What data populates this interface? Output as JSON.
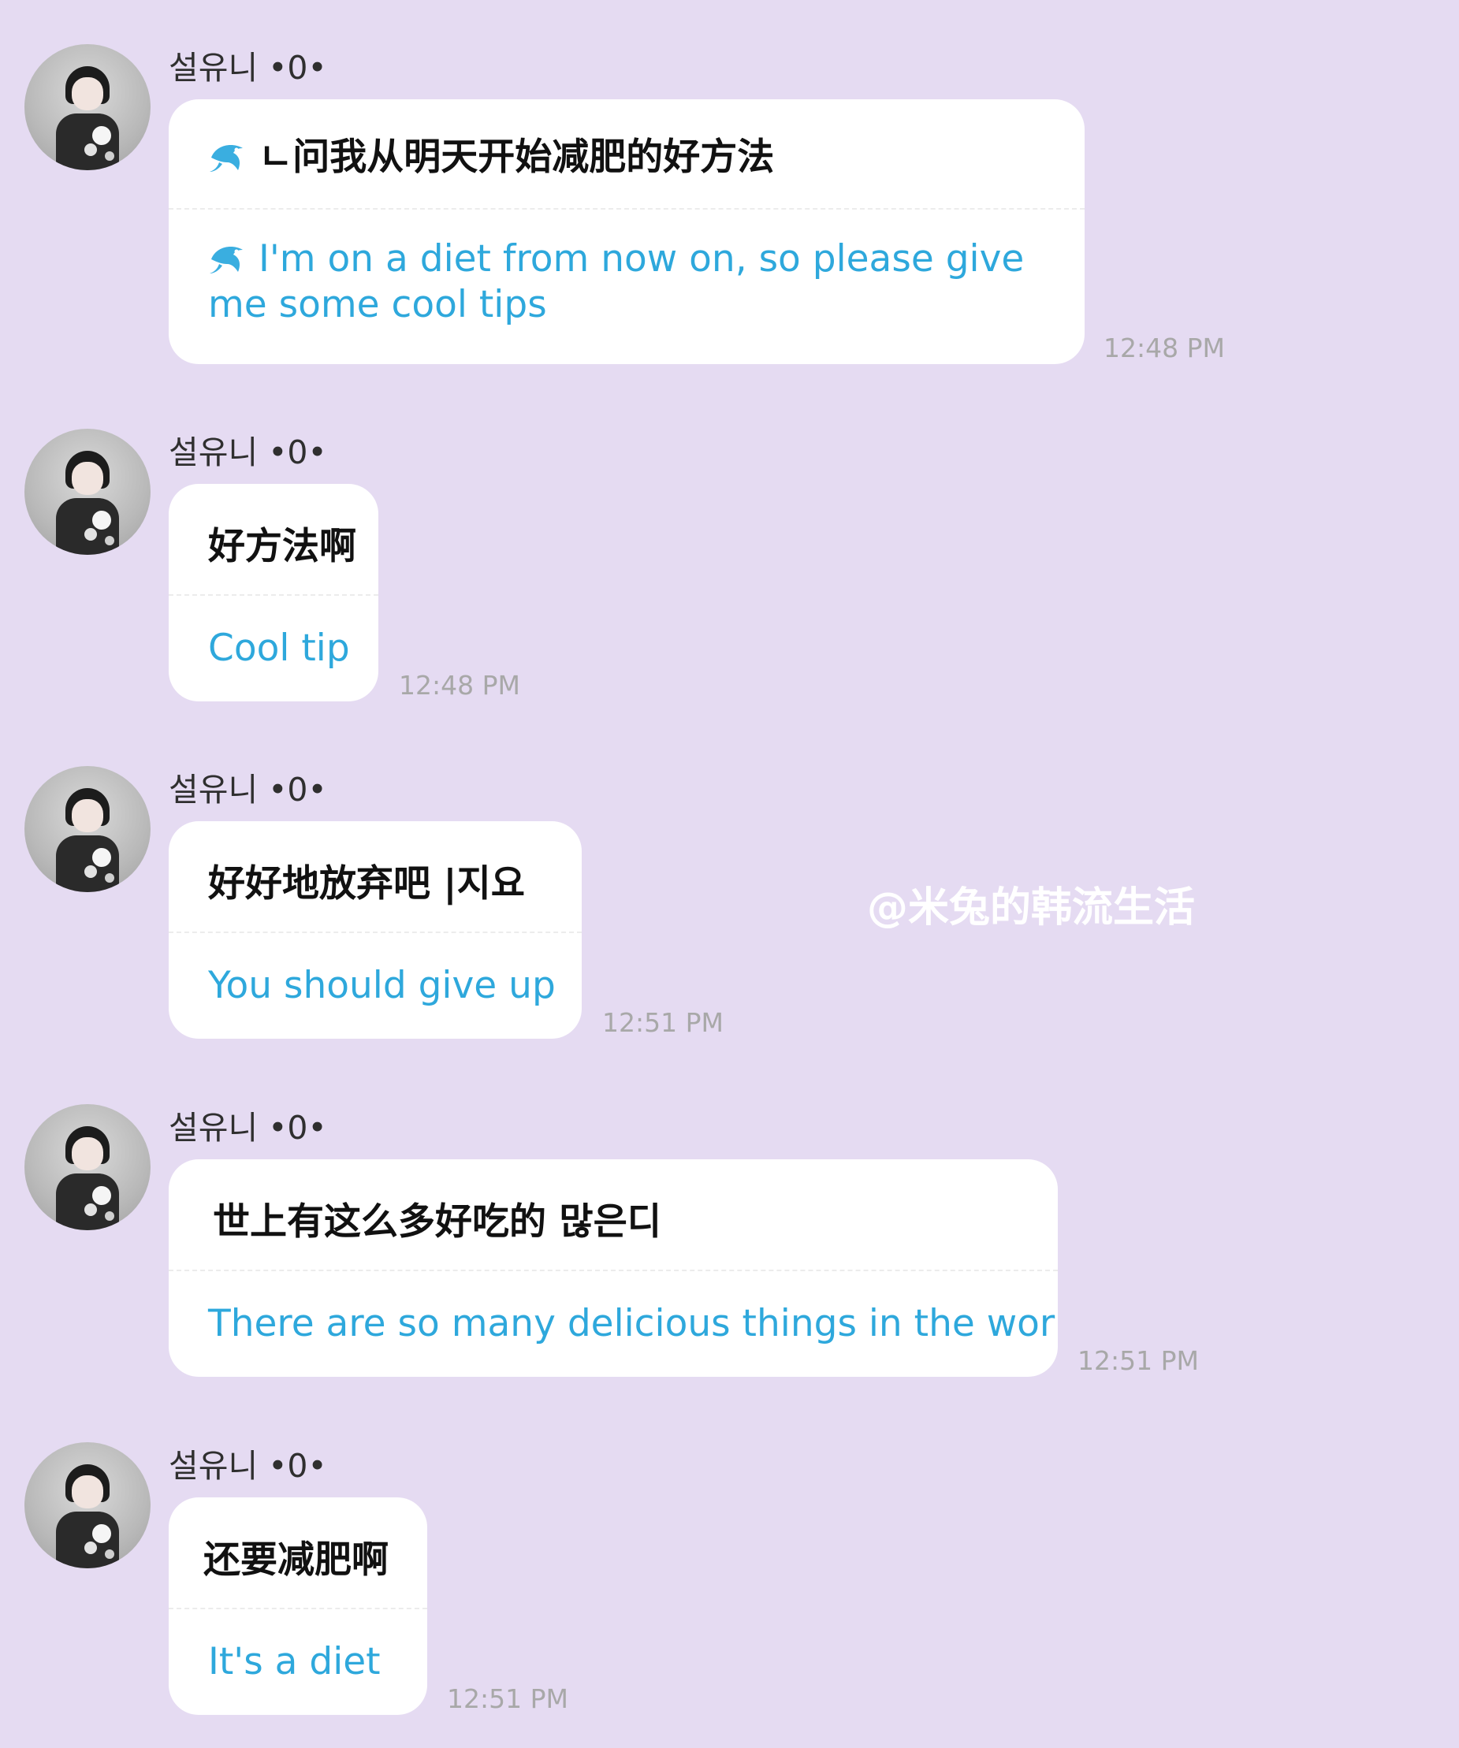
{
  "messages": [
    {
      "sender": "설유니 •0•",
      "original": "ㄴ问我从明天开始减肥的好方法",
      "translation": "I'm on a diet from now on, so please give me some cool tips",
      "time": "12:48 PM",
      "has_dolphin": true
    },
    {
      "sender": "설유니 •0•",
      "original": "好方法啊",
      "translation": "Cool tip",
      "time": "12:48 PM"
    },
    {
      "sender": "설유니 •0•",
      "original": "好好地放弃吧 |지요",
      "translation": "You should give up",
      "time": "12:51 PM"
    },
    {
      "sender": "설유니 •0•",
      "original": "世上有这么多好吃的 많은디",
      "translation": "There are so many delicious things in the world",
      "time": "12:51 PM"
    },
    {
      "sender": "설유니 •0•",
      "original": "还要减肥啊",
      "translation": "It's a diet",
      "time": "12:51 PM"
    }
  ],
  "watermark": "@米兔的韩流生活",
  "colors": {
    "background": "#e5dbf2",
    "bubble": "#ffffff",
    "translation_text": "#2ea8dc",
    "time_text": "#a8a8a8",
    "dolphin_icon": "#3aaee0"
  },
  "icons": {
    "translation_marker": "dolphin-icon",
    "avatar": "profile-photo"
  }
}
